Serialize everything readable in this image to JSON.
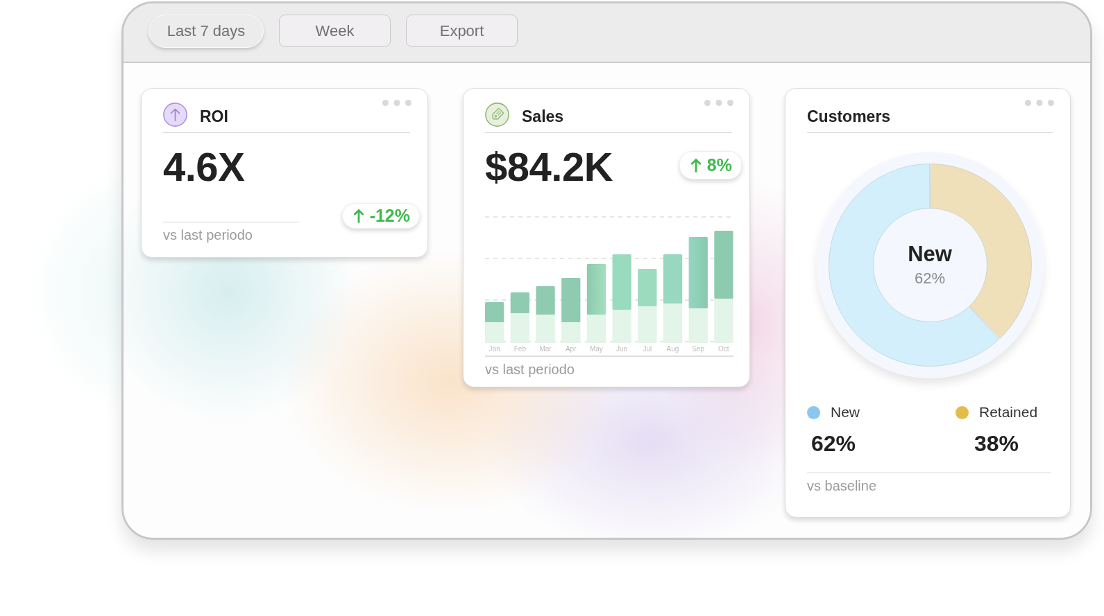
{
  "toolbar": {
    "buttons": [
      {
        "label": "Last 7 days",
        "kind": "pill"
      },
      {
        "label": "Week",
        "kind": "outline"
      },
      {
        "label": "Export",
        "kind": "outline"
      }
    ]
  },
  "cards": [
    {
      "kind": "metric",
      "title": "ROI",
      "value": "4.6X",
      "change": "-12%",
      "footer": "vs last periodo"
    },
    {
      "kind": "chart",
      "title": "Sales",
      "value": "$84.2K",
      "change": "8%",
      "months": [
        "Jan",
        "Feb",
        "Mar",
        "Apr",
        "May",
        "Jun",
        "Jul",
        "Aug",
        "Sep",
        "Oct"
      ],
      "footer": "vs last periodo"
    },
    {
      "kind": "donut",
      "title": "Customers",
      "center_label": "New",
      "center_value": "62%",
      "chart_data": {
        "type": "donut",
        "categories": [
          "New",
          "Retained"
        ],
        "values": [
          62,
          38
        ],
        "colors": [
          "#d3effc",
          "#efe0ba"
        ]
      },
      "legend": [
        {
          "value": "62%",
          "color": "#8cc6ee"
        },
        {
          "value": "38%",
          "color": "#e3bd4c"
        }
      ],
      "footer": "vs baseline"
    }
  ]
}
